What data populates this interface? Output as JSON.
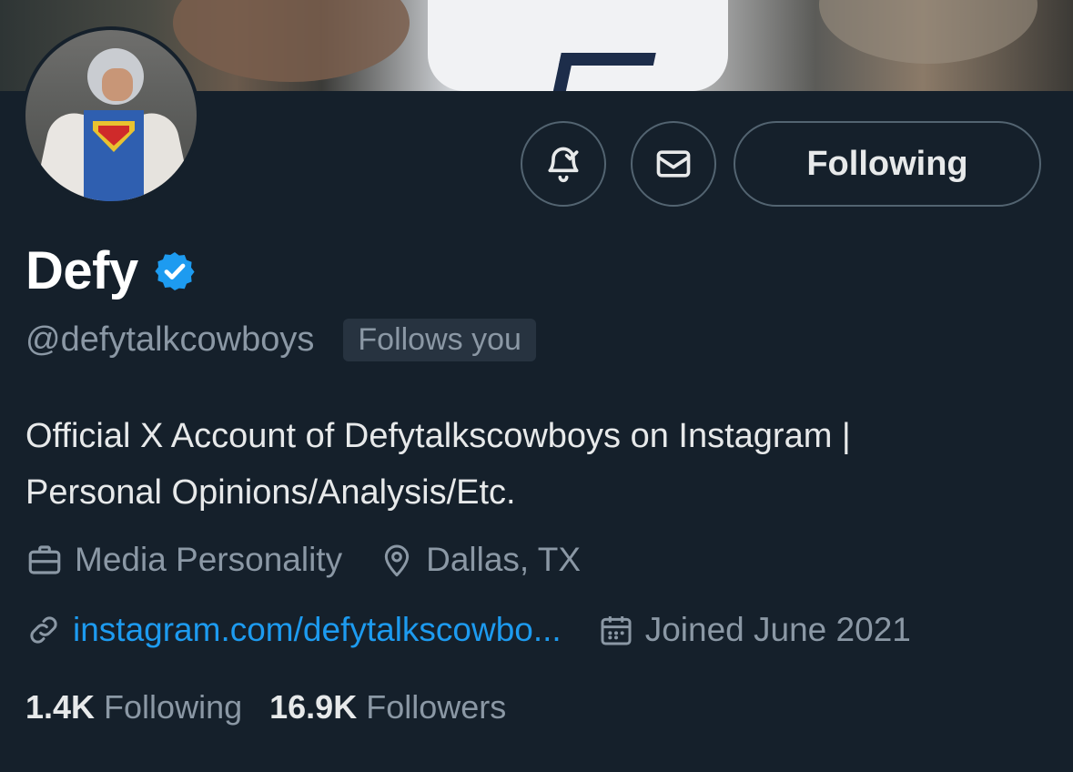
{
  "profile": {
    "name": "Defy",
    "handle": "@defytalkcowboys",
    "follows_you": "Follows you",
    "bio_line1": "Official X Account of Defytalkscowboys on Instagram |",
    "bio_line2": "Personal Opinions/Analysis/Etc.",
    "category": "Media Personality",
    "location": "Dallas, TX",
    "website": "instagram.com/defytalkscowbo...",
    "joined": "Joined June 2021",
    "following_count": "1.4K",
    "following_label": "Following",
    "followers_count": "16.9K",
    "followers_label": "Followers"
  },
  "actions": {
    "notify_icon": "bell-check-icon",
    "message_icon": "envelope-icon",
    "follow_state_label": "Following"
  },
  "colors": {
    "background": "#15202b",
    "text_primary": "#e7e9ea",
    "text_secondary": "#8b98a5",
    "link": "#1d9bf0",
    "verified": "#1d9bf0"
  }
}
